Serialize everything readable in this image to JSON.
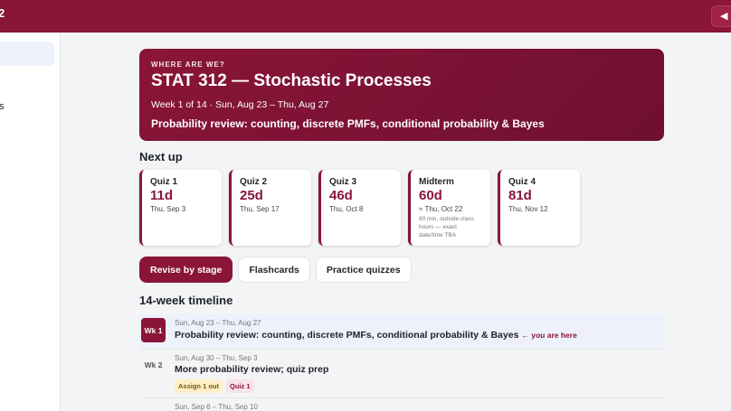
{
  "topbar": {
    "brand_fragment": "2",
    "toggle_icon": "◀"
  },
  "sidebar": {
    "item_fragment": "s"
  },
  "hero": {
    "eyebrow": "WHERE ARE WE?",
    "title": "STAT 312 — Stochastic Processes",
    "week": "Week 1 of 14 · Sun, Aug 23 – Thu, Aug 27",
    "topic": "Probability review: counting, discrete PMFs, conditional probability & Bayes"
  },
  "next_up": {
    "heading": "Next up",
    "cards": [
      {
        "name": "Quiz 1",
        "days": "11d",
        "date": "Thu, Sep 3",
        "note": ""
      },
      {
        "name": "Quiz 2",
        "days": "25d",
        "date": "Thu, Sep 17",
        "note": ""
      },
      {
        "name": "Quiz 3",
        "days": "46d",
        "date": "Thu, Oct 8",
        "note": ""
      },
      {
        "name": "Midterm",
        "days": "60d",
        "date": "≈ Thu, Oct 22",
        "note": "90 min, outside class hours — exact date/time TBA"
      },
      {
        "name": "Quiz 4",
        "days": "81d",
        "date": "Thu, Nov 12",
        "note": ""
      }
    ]
  },
  "tabs": [
    "Revise by stage",
    "Flashcards",
    "Practice quizzes"
  ],
  "timeline": {
    "heading": "14-week timeline",
    "rows": [
      {
        "wk": "Wk 1",
        "dates": "Sun, Aug 23 – Thu, Aug 27",
        "topic": "Probability review: counting, discrete PMFs, conditional probability & Bayes",
        "here": "← you are here",
        "badges": []
      },
      {
        "wk": "Wk 2",
        "dates": "Sun, Aug 30 – Thu, Sep 3",
        "topic": "More probability review; quiz prep",
        "here": "",
        "badges": [
          "Assign 1 out",
          "Quiz 1"
        ]
      },
      {
        "wk": "",
        "dates": "Sun, Sep 6 – Thu, Sep 10",
        "topic": "",
        "here": "",
        "badges": []
      }
    ]
  },
  "colors": {
    "brand": "#8a1538",
    "current_row": "#eef1fb"
  }
}
